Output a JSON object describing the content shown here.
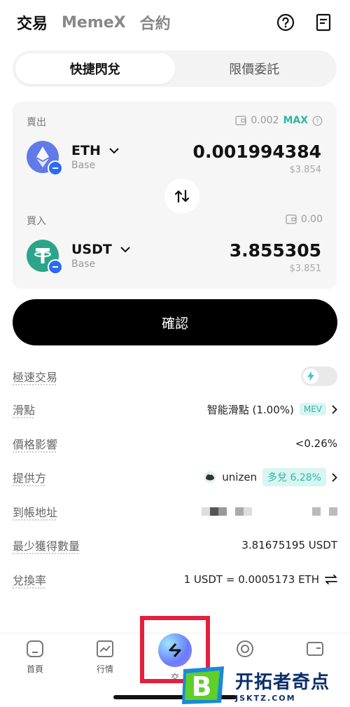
{
  "top_nav": {
    "tabs": [
      "交易",
      "MemeX",
      "合約"
    ],
    "active_tab": 0,
    "help_icon": "help-circle-icon",
    "orders_icon": "document-icon"
  },
  "mode_tabs": {
    "instant": "快捷閃兌",
    "limit": "限價委託",
    "active": "instant"
  },
  "sell": {
    "label": "賣出",
    "balance": "0.002",
    "max_label": "MAX",
    "token": "ETH",
    "chain": "Base",
    "amount": "0.001994384",
    "usd": "$3.854"
  },
  "buy": {
    "label": "買入",
    "balance": "0.00",
    "token": "USDT",
    "chain": "Base",
    "amount": "3.855305",
    "usd": "$3.851"
  },
  "confirm_label": "確認",
  "details": {
    "turbo": {
      "label": "極速交易",
      "enabled": false
    },
    "slippage": {
      "label": "滑點",
      "value": "智能滑點 (1.00%)",
      "badge": "MEV"
    },
    "price_impact": {
      "label": "價格影響",
      "value": "<0.26%"
    },
    "provider": {
      "label": "提供方",
      "value": "unizen",
      "badge": "多兌 6.28%"
    },
    "recipient": {
      "label": "到帳地址"
    },
    "min_received": {
      "label": "最少獲得數量",
      "value": "3.81675195 USDT"
    },
    "rate": {
      "label": "兌換率",
      "value": "1 USDT = 0.0005173 ETH"
    }
  },
  "bottom_nav": {
    "items": [
      {
        "label": "首頁",
        "icon": "home-icon"
      },
      {
        "label": "行情",
        "icon": "chart-icon"
      },
      {
        "label": "交",
        "icon": "swap-logo-icon"
      },
      {
        "label": "",
        "icon": "earn-icon"
      },
      {
        "label": "",
        "icon": "wallet-icon"
      }
    ]
  },
  "watermark": {
    "title": "开拓者奇点",
    "subtitle": "JSKTZ.COM"
  },
  "colors": {
    "accent": "#2cb7a6",
    "highlight": "#e51f3d",
    "chain": "#2b6bf3"
  }
}
